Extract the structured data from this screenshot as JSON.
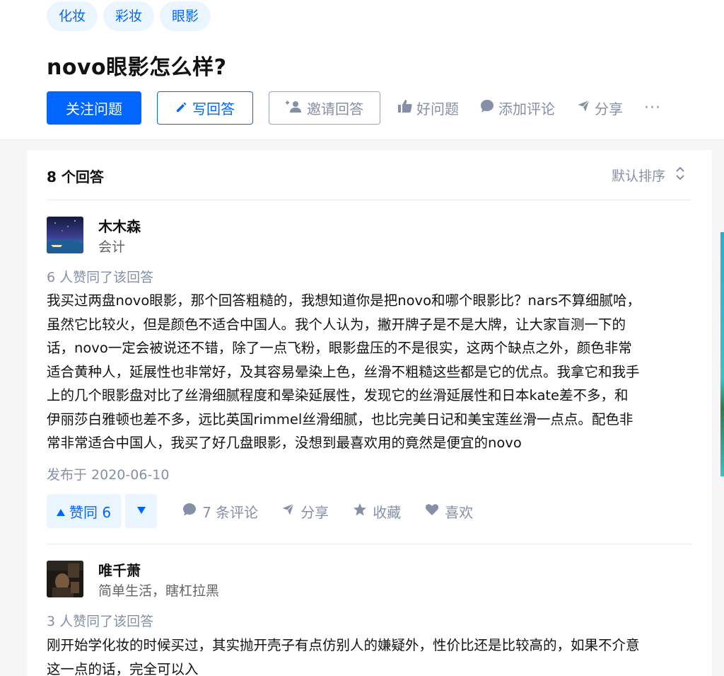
{
  "question": {
    "topics": [
      "化妆",
      "彩妆",
      "眼影"
    ],
    "title": "novo眼影怎么样?",
    "actions": {
      "follow": "关注问题",
      "write": "写回答",
      "invite": "邀请回答",
      "good_question": "好问题",
      "add_comment": "添加评论",
      "share": "分享",
      "more": "···"
    }
  },
  "answers_header": {
    "count": "8 个回答",
    "sort": "默认排序"
  },
  "answers": [
    {
      "author_name": "木木森",
      "author_bio": "会计",
      "voters": "6 人赞同了该回答",
      "lines": [
        "我买过两盘novo眼影，那个回答粗糙的，我想知道你是把novo和哪个眼影比？nars不算细腻哈，",
        "虽然它比较火，但是颜色不适合中国人。我个人认为，撇开牌子是不是大牌，让大家盲测一下的",
        "话，novo一定会被说还不错，除了一点飞粉，眼影盘压的不是很实，这两个缺点之外，颜色非常",
        "适合黄种人，延展性也非常好，及其容易晕染上色，丝滑不粗糙这些都是它的优点。我拿它和我手",
        "上的几个眼影盘对比了丝滑细腻程度和晕染延展性，发现它的丝滑延展性和日本kate差不多，和",
        "伊丽莎白雅顿也差不多，远比英国rimmel丝滑细腻，也比完美日记和美宝莲丝滑一点点。配色非",
        "常非常适合中国人，我买了好几盘眼影，没想到最喜欢用的竟然是便宜的novo"
      ],
      "date": "发布于 2020-06-10",
      "vote_up": "赞同 6",
      "comments": "7 条评论",
      "share": "分享",
      "favorite": "收藏",
      "like": "喜欢"
    },
    {
      "author_name": "唯千萧",
      "author_bio": "简单生活，瞎杠拉黑",
      "voters": "3 人赞同了该回答",
      "lines": [
        "刚开始学化妆的时候买过，其实抛开壳子有点仿别人的嫌疑外，性价比还是比较高的，如果不介意",
        "这一点的话，完全可以入"
      ]
    }
  ],
  "colors": {
    "accent": "#0066ff",
    "muted": "#8590a6",
    "tag_bg": "#ebf5ff"
  }
}
